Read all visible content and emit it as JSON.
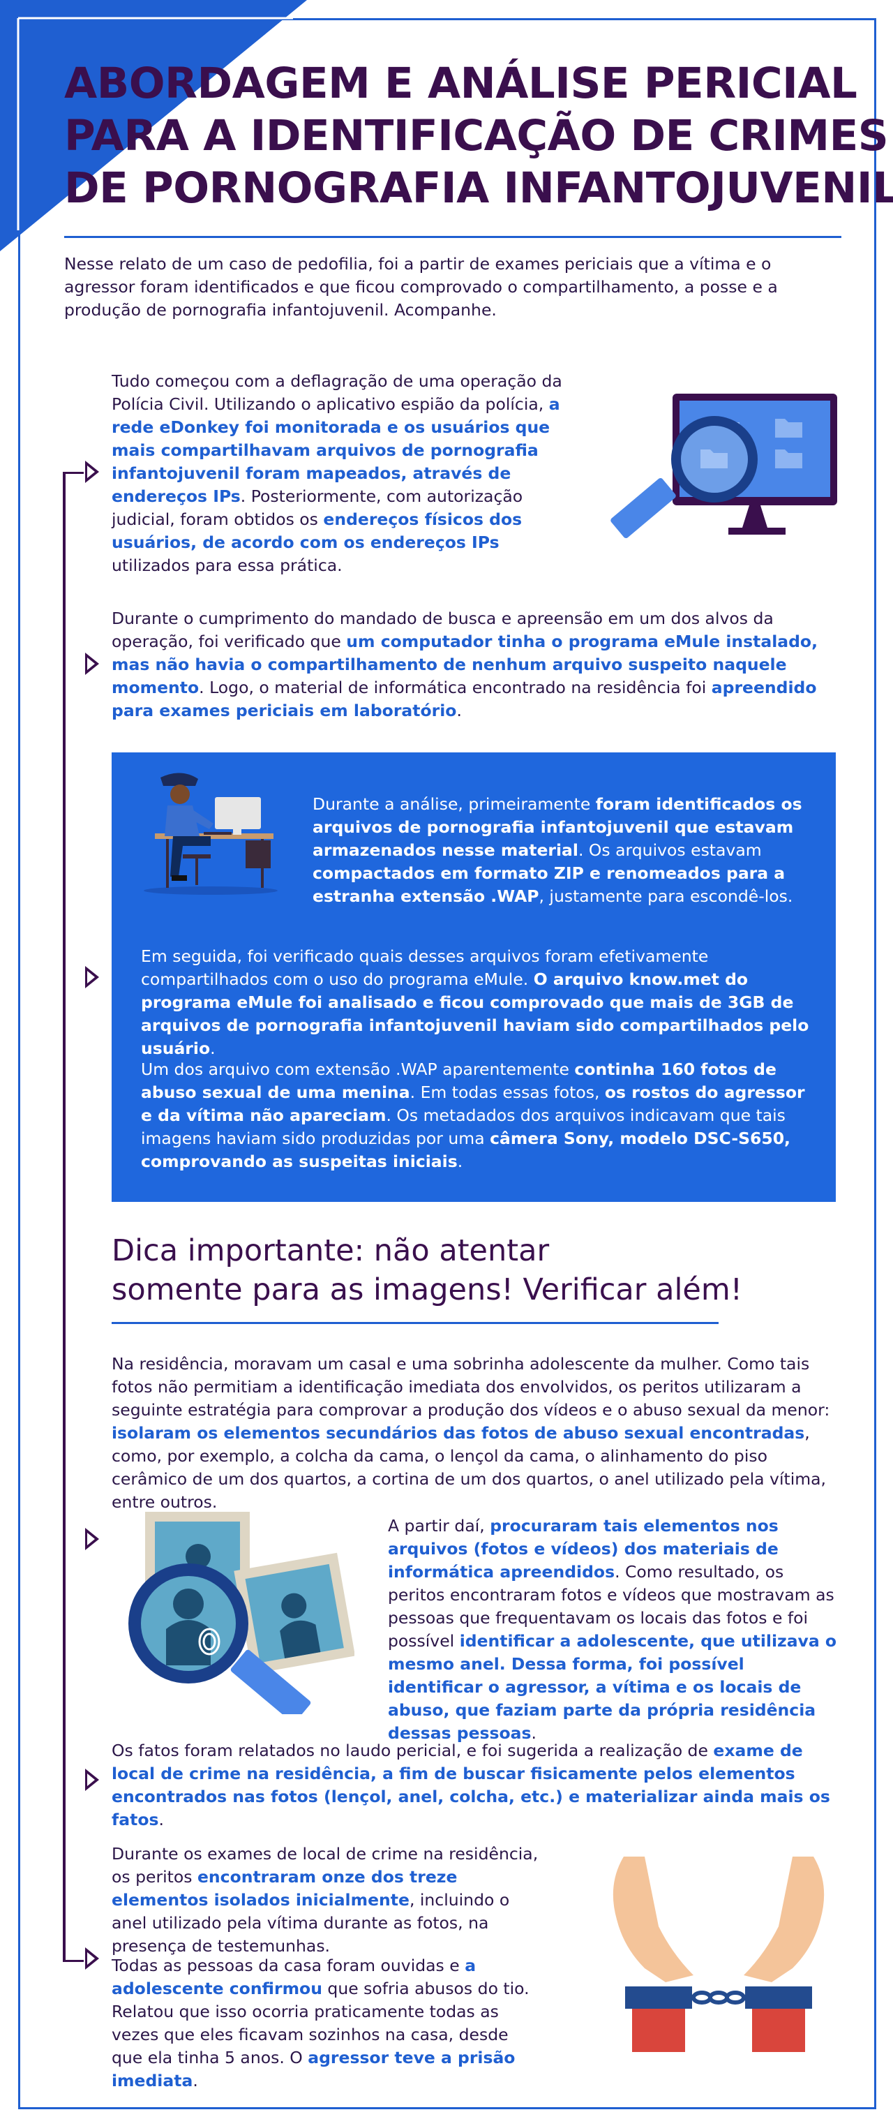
{
  "colors": {
    "primary": "#1f5fd1",
    "dark": "#3a0f4d",
    "box": "#1f67dd"
  },
  "title": [
    "ABORDAGEM E ANÁLISE PERICIAL",
    "PARA A IDENTIFICAÇÃO DE CRIMES",
    "DE PORNOGRAFIA INFANTOJUVENIL"
  ],
  "intro": "Nesse relato de um caso de pedofilia, foi a partir de exames periciais que a vítima e o agressor foram identificados e que ficou comprovado o compartilhamento, a posse e a produção de pornografia infantojuvenil. Acompanhe.",
  "s1": {
    "t1": "Tudo começou com a deflagração de uma operação da Polícia Civil. Utilizando o aplicativo espião da polícia, ",
    "h1": "a rede eDonkey foi monitorada e os usuários que mais compartilhavam arquivos de pornografia infantojuvenil foram mapeados, através de endereços IPs",
    "t2": ". Posteriormente, com autorização judicial, foram obtidos os ",
    "h2": "endereços físicos dos usuários, de acordo com os endereços IPs",
    "t3": " utilizados para essa prática."
  },
  "s2": {
    "t1": "Durante o cumprimento do mandado de busca e apreensão em um dos alvos da operação, foi verificado que ",
    "h1": "um computador tinha o programa eMule instalado, mas não havia o compartilhamento de nenhum arquivo suspeito naquele momento",
    "t2": ". Logo, o material de informática encontrado na residência foi ",
    "h2": "apreendido para exames periciais em laboratório",
    "t3": "."
  },
  "s3": {
    "t1": "Durante a análise, primeiramente ",
    "h1": "foram identificados os arquivos de pornografia infantojuvenil que estavam armazenados nesse material",
    "t2": ". Os arquivos estavam ",
    "h2": "compactados em formato ZIP e renomeados para a estranha extensão .WAP",
    "t3": ", justamente para escondê-los."
  },
  "s4": {
    "t1": "Em seguida, foi verificado quais desses arquivos foram efetivamente compartilhados com o uso do programa eMule. ",
    "h1": "O arquivo know.met do programa eMule foi analisado e ficou comprovado  que mais de 3GB de arquivos de pornografia infantojuvenil haviam sido compartilhados pelo usuário",
    "t2": "."
  },
  "s5": {
    "t1": "Um dos arquivo com extensão .WAP aparentemente ",
    "h1": "continha 160 fotos de abuso sexual de uma menina",
    "t2": ". Em todas essas fotos, ",
    "h2": "os rostos do agressor e da vítima não apareciam",
    "t3": ". Os metadados dos arquivos indicavam que tais imagens haviam sido produzidas por uma ",
    "h3": "câmera Sony, modelo DSC-S650, comprovando as suspeitas iniciais",
    "t4": "."
  },
  "tip": [
    "Dica importante: não atentar",
    "somente para as imagens! Verificar além!"
  ],
  "s6": {
    "t1": "Na residência, moravam um casal e uma sobrinha adolescente da mulher. Como tais fotos não permitiam a identificação imediata dos envolvidos, os peritos utilizaram a seguinte estratégia para comprovar a produção dos vídeos e o abuso sexual da menor: ",
    "h1": "isolaram os elementos secundários das fotos de abuso sexual encontradas",
    "t2": ", como, por exemplo, a colcha da cama, o lençol da cama, o alinhamento do piso cerâmico de um dos quartos, a cortina de um dos quartos, o anel utilizado pela vítima, entre outros."
  },
  "s7": {
    "t1": "A partir daí, ",
    "h1": "procuraram tais elementos nos arquivos (fotos e vídeos) dos materiais de informática apreendidos",
    "t2": ". Como resultado, os peritos encontraram fotos e vídeos que mostravam as pessoas que frequentavam os locais das fotos e foi possível ",
    "h2": "identificar a adolescente, que utilizava o mesmo anel. Dessa forma, foi possível identificar o agressor, a vítima e os locais de abuso, que faziam parte da própria residência dessas pessoas",
    "t3": "."
  },
  "s8": {
    "t1": "Os fatos foram relatados no laudo pericial, e foi sugerida a realização de ",
    "h1": "exame de local de crime na residência, a fim de buscar fisicamente pelos elementos encontrados nas fotos (lençol, anel, colcha, etc.) e materializar ainda mais os fatos",
    "t2": "."
  },
  "s9": {
    "t1": "Durante os exames de local de crime na residência, os peritos ",
    "h1": "encontraram onze dos treze elementos isolados inicialmente",
    "t2": ", incluindo o anel utilizado pela vítima durante as fotos, na presença de testemunhas."
  },
  "s10": {
    "t1": "Todas as pessoas da casa foram ouvidas e ",
    "h1": "a adolescente confirmou",
    "t2": " que sofria abusos do tio. Relatou que isso ocorria praticamente todas as vezes que eles ficavam sozinhos na casa, desde que ela tinha 5 anos. O ",
    "h2": "agressor teve a prisão imediata",
    "t3": "."
  }
}
